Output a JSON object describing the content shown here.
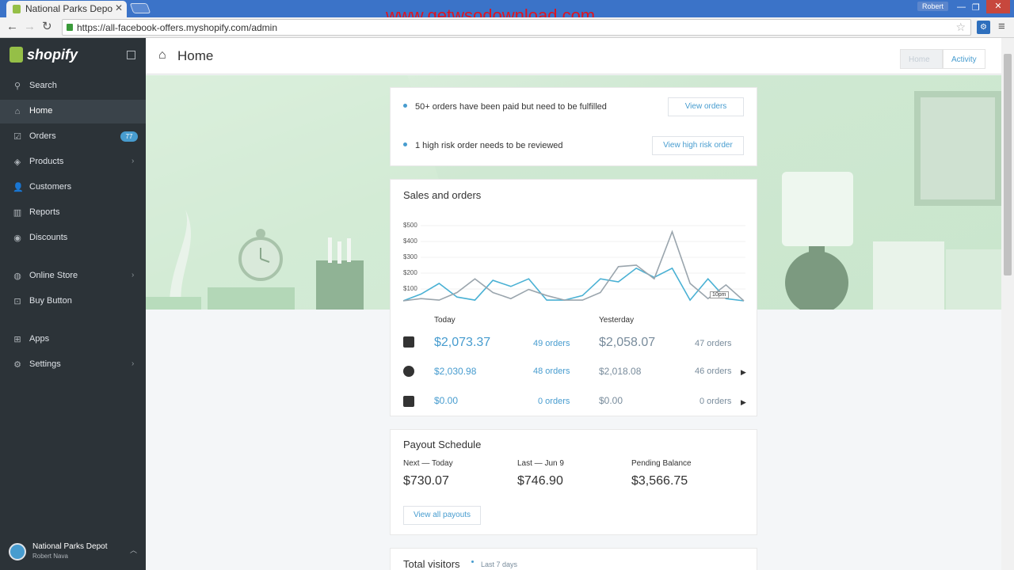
{
  "browser": {
    "tab_title": "National Parks Depo",
    "url": "https://all-facebook-offers.myshopify.com/admin",
    "watermark": "www.getwsodownload.com",
    "user_chip": "Robert"
  },
  "sidebar": {
    "logo": "shopify",
    "items": [
      {
        "label": "Search"
      },
      {
        "label": "Home"
      },
      {
        "label": "Orders",
        "badge": "77"
      },
      {
        "label": "Products"
      },
      {
        "label": "Customers"
      },
      {
        "label": "Reports"
      },
      {
        "label": "Discounts"
      },
      {
        "label": "Online Store"
      },
      {
        "label": "Buy Button"
      },
      {
        "label": "Apps"
      },
      {
        "label": "Settings"
      }
    ],
    "store_name": "National Parks Depot",
    "store_user": "Robert Nava"
  },
  "header": {
    "title": "Home",
    "seg_home": "Home",
    "seg_activity": "Activity"
  },
  "alerts": [
    {
      "text": "50+ orders have been paid but need to be fulfilled",
      "button": "View orders"
    },
    {
      "text": "1 high risk order needs to be reviewed",
      "button": "View high risk order"
    }
  ],
  "sales": {
    "title": "Sales and orders",
    "today_label": "Today",
    "yesterday_label": "Yesterday",
    "rows": [
      {
        "today_total": "$2,073.37",
        "today_orders": "49 orders",
        "yesterday_total": "$2,058.07",
        "yesterday_orders": "47 orders"
      },
      {
        "today_total": "$2,030.98",
        "today_orders": "48 orders",
        "yesterday_total": "$2,018.08",
        "yesterday_orders": "46 orders"
      },
      {
        "today_total": "$0.00",
        "today_orders": "0 orders",
        "yesterday_total": "$0.00",
        "yesterday_orders": "0 orders"
      }
    ],
    "tooltip": "10pm"
  },
  "chart_data": {
    "type": "line",
    "yticks": [
      "$500",
      "$400",
      "$300",
      "$200",
      "$100"
    ],
    "ylim": [
      0,
      500
    ],
    "series": [
      {
        "color": "#4ab1d4",
        "values": [
          5,
          50,
          120,
          30,
          10,
          140,
          100,
          150,
          10,
          10,
          40,
          150,
          130,
          220,
          160,
          220,
          10,
          150,
          20,
          5
        ]
      },
      {
        "color": "#9aa5ad",
        "values": [
          5,
          20,
          10,
          60,
          150,
          60,
          20,
          80,
          40,
          10,
          10,
          60,
          230,
          240,
          150,
          460,
          120,
          20,
          110,
          5
        ]
      }
    ]
  },
  "payout": {
    "title": "Payout Schedule",
    "next_label": "Next — Today",
    "next_value": "$730.07",
    "last_label": "Last — Jun 9",
    "last_value": "$746.90",
    "pending_label": "Pending Balance",
    "pending_value": "$3,566.75",
    "button": "View all payouts"
  },
  "visitors": {
    "title": "Total visitors",
    "sub": "Last 7 days"
  }
}
